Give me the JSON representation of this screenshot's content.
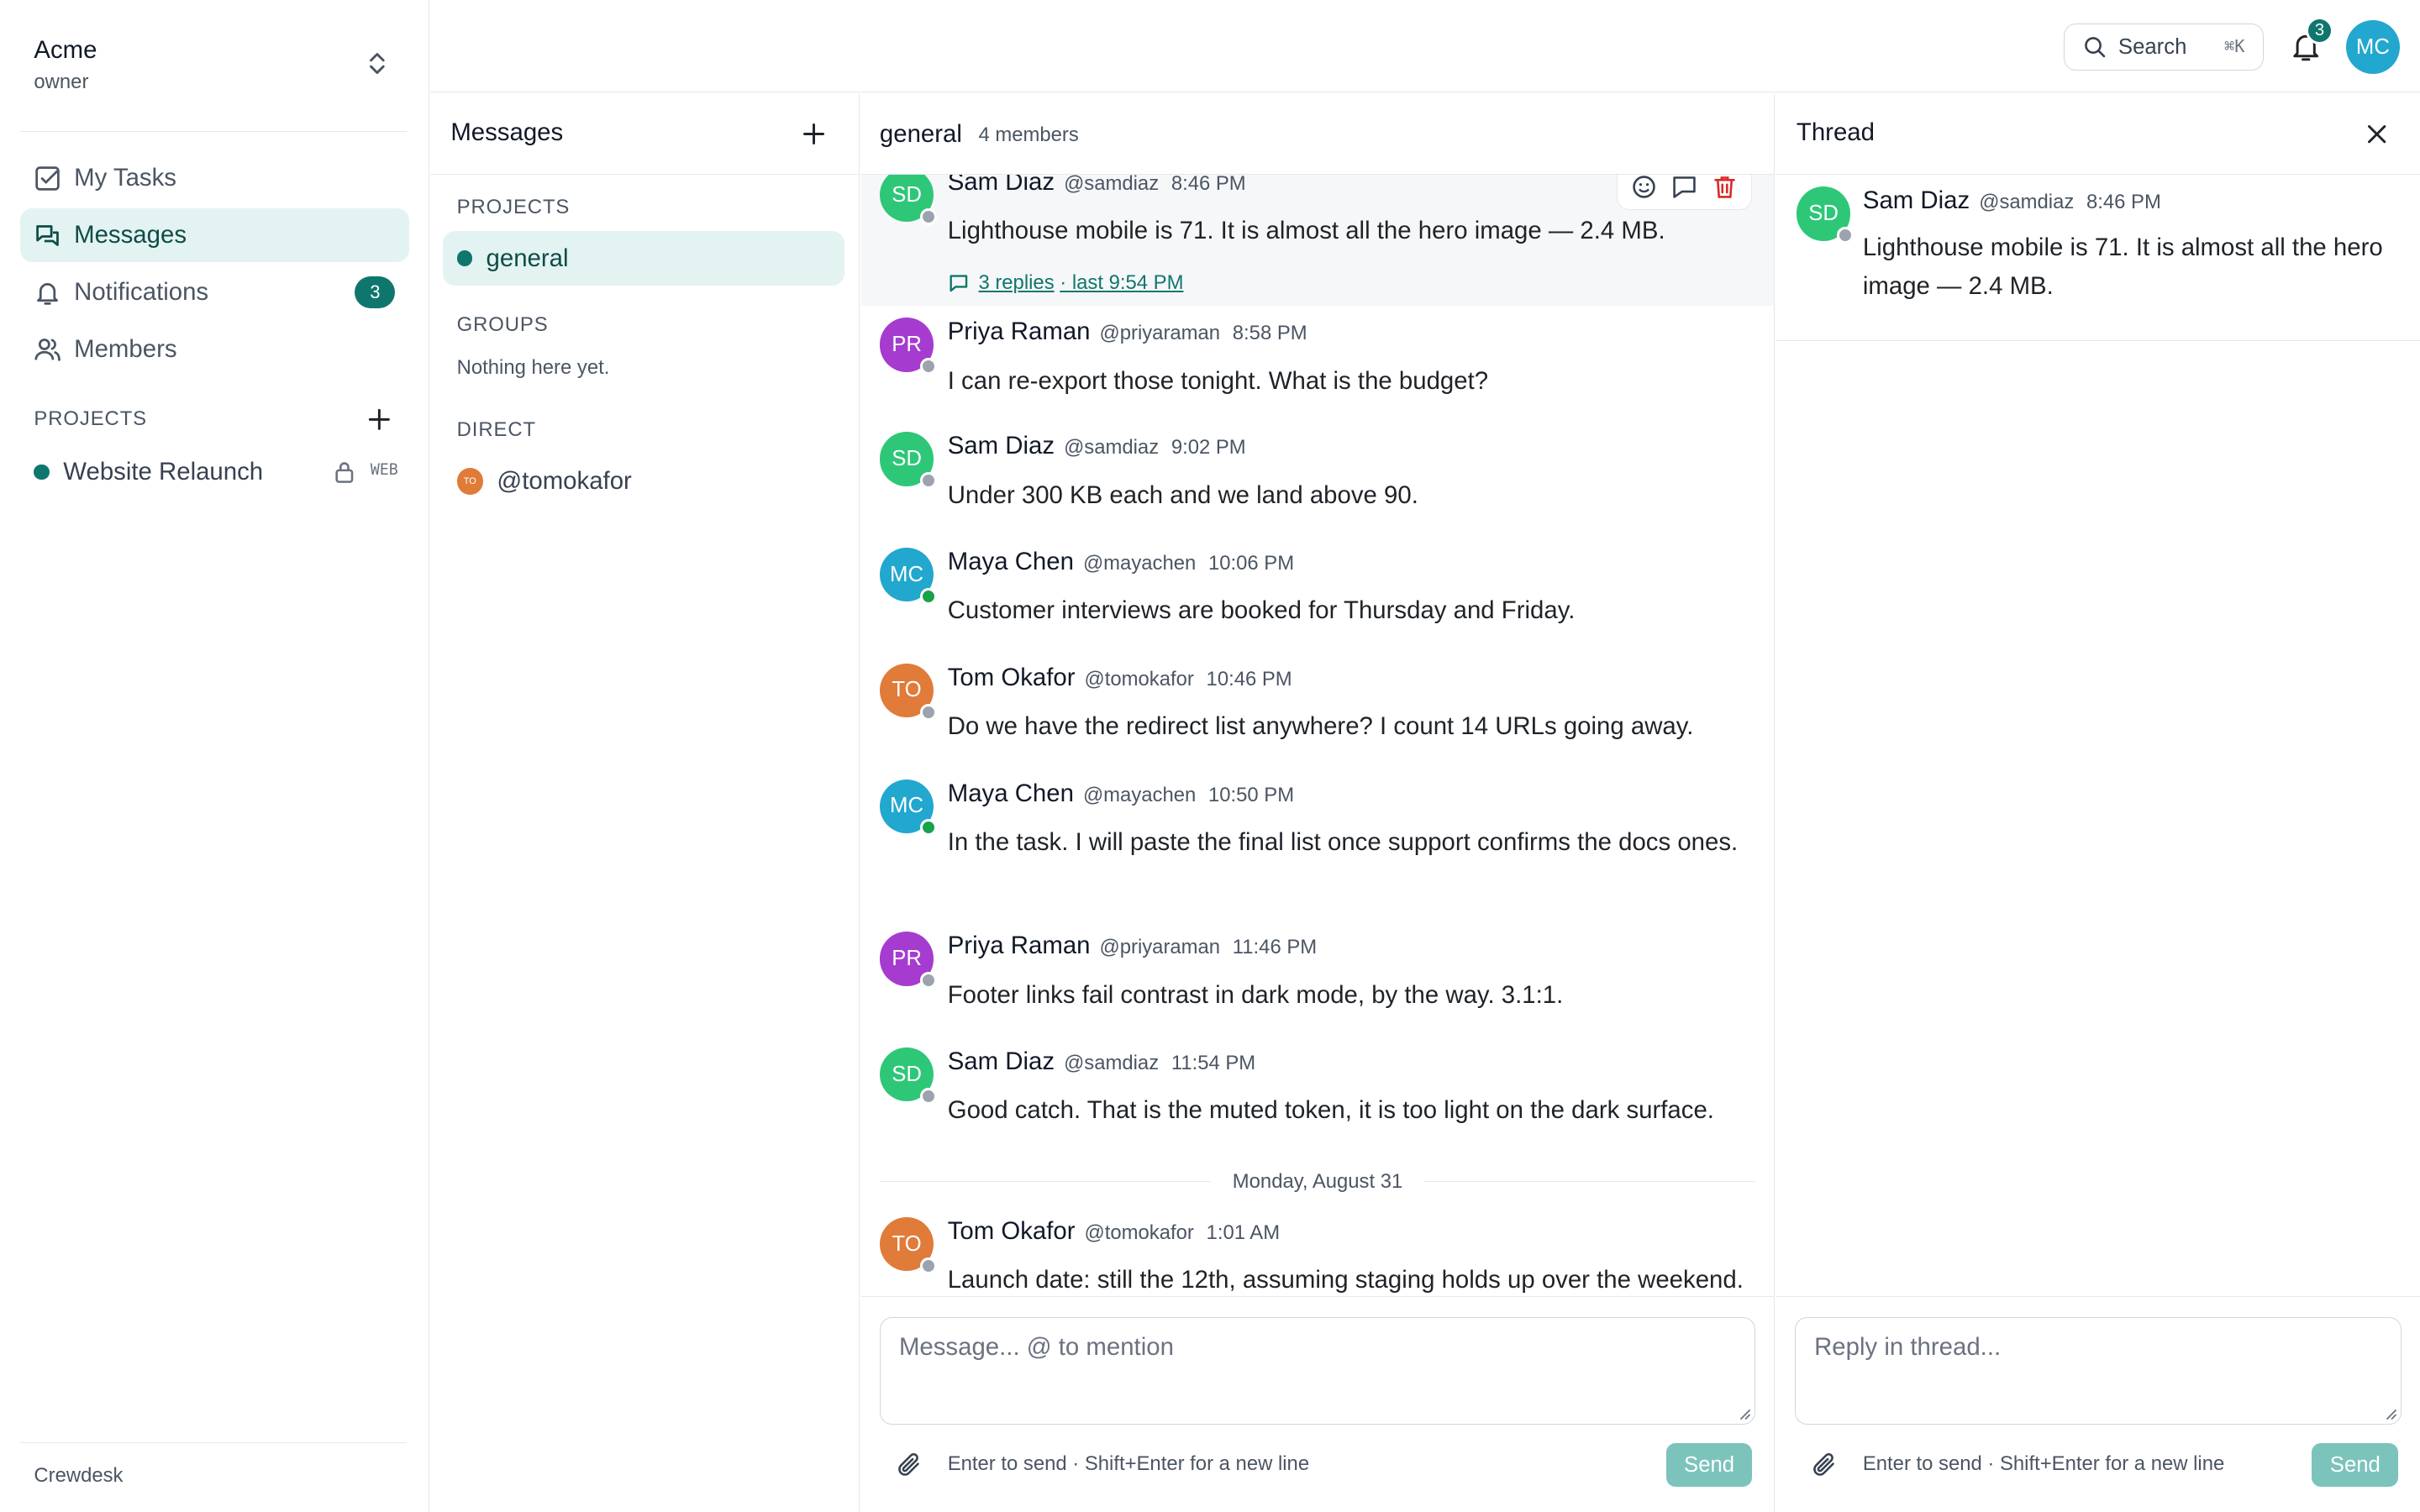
{
  "workspace": {
    "name": "Acme",
    "role": "owner"
  },
  "nav": [
    {
      "label": "My Tasks",
      "icon": "checkbox-icon"
    },
    {
      "label": "Messages",
      "icon": "chat-icon"
    },
    {
      "label": "Notifications",
      "icon": "bell-icon",
      "badge": "3"
    },
    {
      "label": "Members",
      "icon": "users-icon"
    }
  ],
  "sidebar": {
    "projects_label": "PROJECTS",
    "project": {
      "name": "Website Relaunch",
      "tag": "WEB"
    },
    "footer": "Crewdesk"
  },
  "topbar": {
    "search_label": "Search",
    "search_kbd": "⌘K",
    "notif_count": "3",
    "avatar": "MC"
  },
  "messages_pane": {
    "title": "Messages",
    "projects_label": "PROJECTS",
    "channel": "general",
    "groups_label": "GROUPS",
    "groups_empty": "Nothing here yet.",
    "direct_label": "DIRECT",
    "dm": {
      "initials": "TO",
      "handle": "@tomokafor"
    }
  },
  "channel": {
    "name": "general",
    "members": "4 members",
    "messages": [
      {
        "initials": "SD",
        "name": "Sam Diaz",
        "handle": "@samdiaz",
        "time": "8:46 PM",
        "text": "Lighthouse mobile is 71. It is almost all the hero image — 2.4 MB.",
        "replies": "3 replies",
        "last": "· last 9:54 PM"
      },
      {
        "initials": "PR",
        "name": "Priya Raman",
        "handle": "@priyaraman",
        "time": "8:58 PM",
        "text": "I can re-export those tonight. What is the budget?"
      },
      {
        "initials": "SD",
        "name": "Sam Diaz",
        "handle": "@samdiaz",
        "time": "9:02 PM",
        "text": "Under 300 KB each and we land above 90."
      },
      {
        "initials": "MC",
        "name": "Maya Chen",
        "handle": "@mayachen",
        "time": "10:06 PM",
        "text": "Customer interviews are booked for Thursday and Friday."
      },
      {
        "initials": "TO",
        "name": "Tom Okafor",
        "handle": "@tomokafor",
        "time": "10:46 PM",
        "text": "Do we have the redirect list anywhere? I count 14 URLs going away."
      },
      {
        "initials": "MC",
        "name": "Maya Chen",
        "handle": "@mayachen",
        "time": "10:50 PM",
        "text": "In the task. I will paste the final list once support confirms the docs ones."
      },
      {
        "initials": "PR",
        "name": "Priya Raman",
        "handle": "@priyaraman",
        "time": "11:46 PM",
        "text": "Footer links fail contrast in dark mode, by the way. 3.1:1."
      },
      {
        "initials": "SD",
        "name": "Sam Diaz",
        "handle": "@samdiaz",
        "time": "11:54 PM",
        "text": "Good catch. That is the muted token, it is too light on the dark surface."
      },
      {
        "initials": "TO",
        "name": "Tom Okafor",
        "handle": "@tomokafor",
        "time": "1:01 AM",
        "text": "Launch date: still the 12th, assuming staging holds up over the weekend."
      }
    ],
    "day_separator": "Monday, August 31",
    "composer": {
      "placeholder": "Message... @ to mention",
      "hint": "Enter to send · Shift+Enter for a new line",
      "send": "Send"
    }
  },
  "thread": {
    "title": "Thread",
    "parent": {
      "initials": "SD",
      "name": "Sam Diaz",
      "handle": "@samdiaz",
      "time": "8:46 PM",
      "text": "Lighthouse mobile is 71. It is almost all the hero image — 2.4 MB."
    },
    "composer": {
      "placeholder": "Reply in thread...",
      "hint": "Enter to send · Shift+Enter for a new line",
      "send": "Send"
    }
  },
  "colors": {
    "accent": "#0f766e",
    "active_bg": "#e3f3f1",
    "avatar_sd": "#2ec778",
    "avatar_pr": "#a63ccf",
    "avatar_mc": "#22a7cf",
    "avatar_to": "#e07b39"
  }
}
